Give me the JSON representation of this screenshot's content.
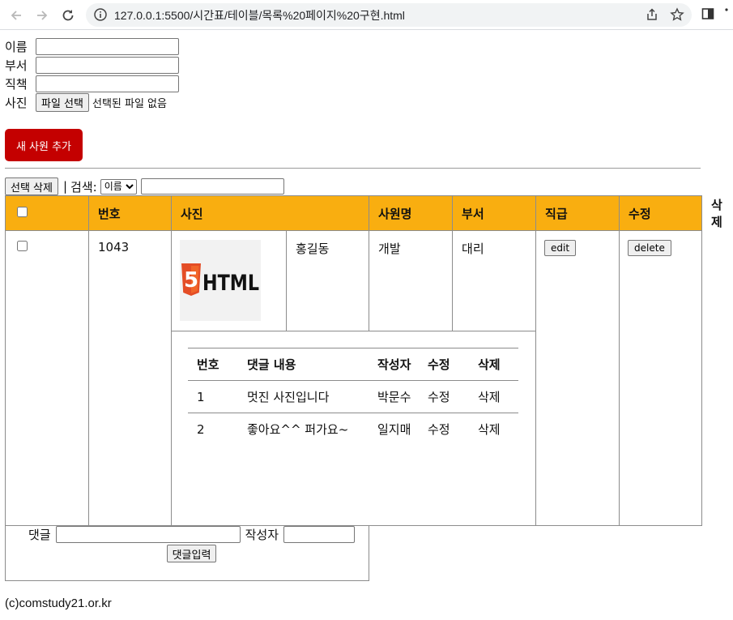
{
  "browser": {
    "url": "127.0.0.1:5500/시간표/테이블/목록%20페이지%20구현.html"
  },
  "form": {
    "name_label": "이름",
    "dept_label": "부서",
    "position_label": "직책",
    "photo_label": "사진",
    "file_button": "파일 선택",
    "file_none": "선택된 파일 없음",
    "add_button": "새 사원 추가"
  },
  "toolbar": {
    "delete_selected": "선택 삭제",
    "separator": "|",
    "search_label": "검색:",
    "search_option": "이름",
    "search_value": ""
  },
  "table": {
    "headers": [
      "번호",
      "사진",
      "사원명",
      "부서",
      "직급",
      "수정",
      "삭제"
    ],
    "row": {
      "id": "1043",
      "photo_text": "HTML",
      "name": "홍길동",
      "dept": "개발",
      "rank": "대리",
      "edit_button": "edit",
      "delete_button": "delete"
    }
  },
  "comments": {
    "headers": [
      "번호",
      "댓글 내용",
      "작성자",
      "수정",
      "삭제"
    ],
    "rows": [
      {
        "no": "1",
        "content": "멋진 사진입니다",
        "author": "박문수",
        "edit": "수정",
        "delete": "삭제"
      },
      {
        "no": "2",
        "content": "좋아요^^ 퍼가요~",
        "author": "일지매",
        "edit": "수정",
        "delete": "삭제"
      }
    ],
    "comment_label": "댓글",
    "author_label": "작성자",
    "submit_button": "댓글입력"
  },
  "footer": "(c)comstudy21.or.kr",
  "colors": {
    "header_bg": "#f9ae10",
    "add_button_bg": "#c40000",
    "html5_logo": "#e44d26"
  }
}
